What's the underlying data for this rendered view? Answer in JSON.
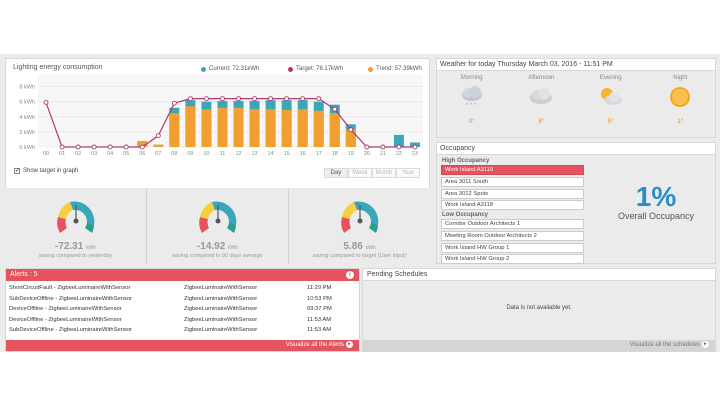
{
  "chart": {
    "title": "Lighting energy consumption",
    "legend": [
      {
        "label": "Current: 72.31kWh",
        "color": "#3aa6b9"
      },
      {
        "label": "Target: 78.17kWh",
        "color": "#b03a6e"
      },
      {
        "label": "Trend: 57.39kWh",
        "color": "#f0a030"
      }
    ],
    "show_target_label": "Show target in graph",
    "show_target_checked": "✓",
    "period_tabs": [
      "Day",
      "Week",
      "Month",
      "Year"
    ]
  },
  "chart_data": {
    "type": "bar",
    "categories": [
      "00",
      "01",
      "02",
      "03",
      "04",
      "05",
      "06",
      "07",
      "08",
      "09",
      "10",
      "11",
      "12",
      "13",
      "14",
      "15",
      "16",
      "17",
      "18",
      "19",
      "20",
      "21",
      "22",
      "23"
    ],
    "ylabel": "",
    "y_ticks": [
      "0 kWh",
      "2 kWh",
      "4 kWh",
      "6 kWh",
      "8 kWh"
    ],
    "ylim": [
      0,
      9
    ],
    "series": [
      {
        "name": "Current",
        "type": "bar",
        "color": "#3aa6b9",
        "values": [
          0,
          0,
          0,
          0,
          0,
          0,
          0.5,
          0.3,
          5.2,
          6.2,
          6.0,
          6.1,
          6.1,
          6.1,
          6.2,
          6.2,
          6.2,
          6.0,
          5.6,
          3.0,
          0,
          0,
          1.6,
          0.6
        ]
      },
      {
        "name": "Trend",
        "type": "bar",
        "color": "#f0a030",
        "values": [
          0,
          0,
          0,
          0,
          0,
          0,
          0.8,
          0.3,
          4.5,
          5.4,
          5.0,
          5.2,
          5.2,
          5.0,
          5.0,
          4.9,
          5.0,
          4.8,
          4.5,
          2.3,
          0,
          0,
          0,
          0
        ]
      },
      {
        "name": "Target",
        "type": "line",
        "color": "#b03a6e",
        "values": [
          5.9,
          0,
          0,
          0,
          0,
          0,
          0,
          1.5,
          5.8,
          6.4,
          6.4,
          6.4,
          6.4,
          6.4,
          6.4,
          6.4,
          6.4,
          6.4,
          5.0,
          2.3,
          0,
          0,
          0,
          0
        ]
      }
    ]
  },
  "gauges": [
    {
      "value": "-72.31",
      "unit": "kWh",
      "caption": "saving compared to yesterday"
    },
    {
      "value": "-14.92",
      "unit": "kWh",
      "caption": "saving compared to 90 days average"
    },
    {
      "value": "5.86",
      "unit": "kWh",
      "caption": "saving compared to target (User input)"
    }
  ],
  "weather": {
    "title": "Weather for today Thursday March 03, 2016 - 11:51 PM",
    "periods": [
      {
        "label": "Morning",
        "icon": "snow-cloud-icon",
        "temp": "0°"
      },
      {
        "label": "Afternoon",
        "icon": "cloud-icon",
        "temp": "8°"
      },
      {
        "label": "Evening",
        "icon": "partly-cloudy-icon",
        "temp": "5°"
      },
      {
        "label": "Night",
        "icon": "sun-icon",
        "temp": "1°"
      }
    ]
  },
  "occupancy": {
    "title": "Occupancy",
    "high_label": "High Occupancy",
    "high_items": [
      "Work Island A3119",
      "Area 3011 South",
      "Area 3012 Spots",
      "Work Island A3118"
    ],
    "low_label": "Low Occupancy",
    "low_items": [
      "Corridor Outdoor Architects 1",
      "Meeting Room Outdoor Architects 2",
      "Work Island HW Group 1",
      "Work Island HW Group 2"
    ],
    "value": "1%",
    "label": "Overall Occupancy"
  },
  "alerts": {
    "title": "Alerts : 5",
    "rows": [
      {
        "type": "ShortCircuitFault - ZigbeeLuminaireWithSensor",
        "device": "ZigbeeLuminaireWithSensor",
        "time": "11:29 PM"
      },
      {
        "type": "SubDeviceOffline - ZigbeeLuminaireWithSensor",
        "device": "ZigbeeLuminaireWithSensor",
        "time": "10:53 PM"
      },
      {
        "type": "DeviceOffline - ZigbeeLuminaireWithSensor",
        "device": "ZigbeeLuminaireWithSensor",
        "time": "09:37 PM"
      },
      {
        "type": "DeviceOffline - ZigbeeLuminaireWithSensor",
        "device": "ZigbeeLuminaireWithSensor",
        "time": "11:53 AM"
      },
      {
        "type": "SubDeviceOffline - ZigbeeLuminaireWithSensor",
        "device": "ZigbeeLuminaireWithSensor",
        "time": "11:53 AM"
      }
    ],
    "footer": "Visualize all the Alerts"
  },
  "schedules": {
    "title": "Pending Schedules",
    "empty": "Data is not available yet.",
    "footer": "Visualize all the schedules"
  },
  "colors": {
    "accent": "#e5545e",
    "occupancy": "#2a8fc8"
  }
}
